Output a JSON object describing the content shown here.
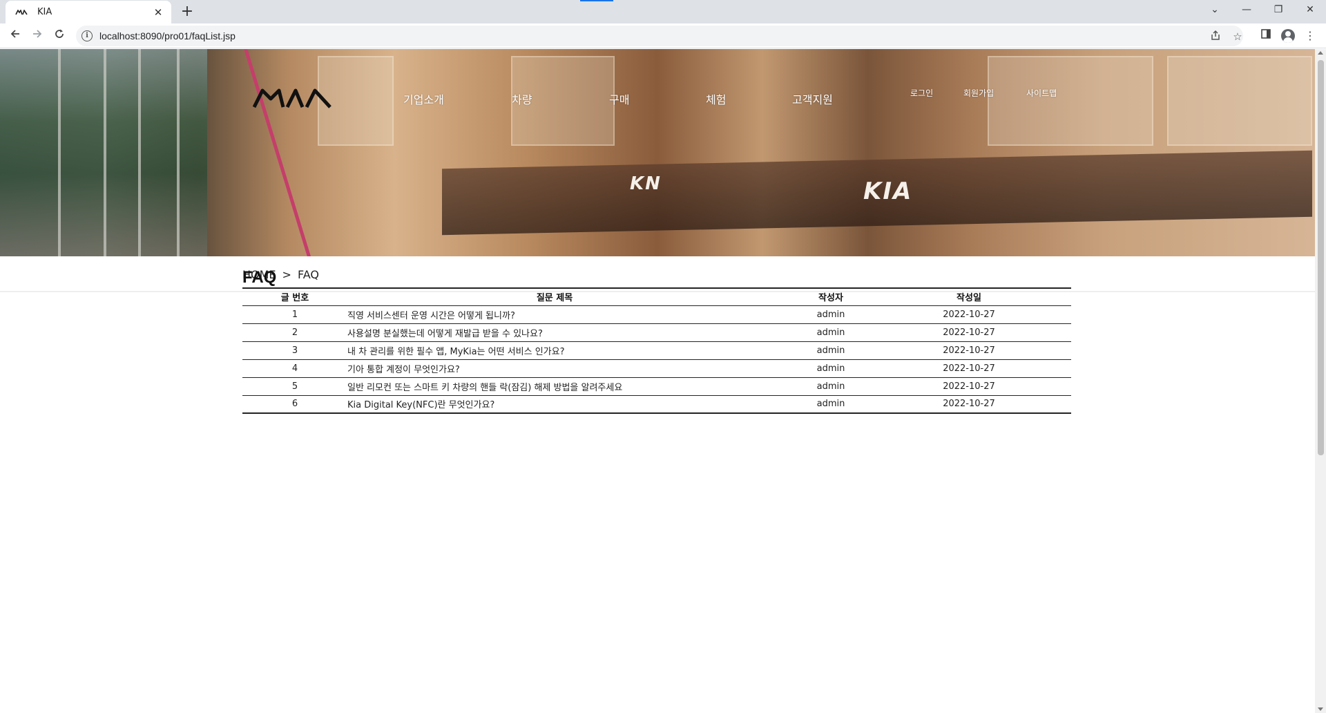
{
  "browser": {
    "tab_title": "KIA",
    "tab_close": "✕",
    "new_tab": "+",
    "url": "localhost:8090/pro01/faqList.jsp",
    "win_controls": {
      "dropdown": "⌄",
      "minimize": "—",
      "restore": "❐",
      "close": "✕"
    }
  },
  "header": {
    "logo": "KIA",
    "nav": [
      "기업소개",
      "차량",
      "구매",
      "체험",
      "고객지원"
    ],
    "util": [
      "로그인",
      "회원가입",
      "사이트맵"
    ],
    "hero_signs": [
      "KN",
      "KIA"
    ]
  },
  "breadcrumb": {
    "home": "HOME",
    "separator": ">",
    "current": "FAQ"
  },
  "page_title": "FAQ",
  "table": {
    "headers": {
      "num": "글 번호",
      "title": "질문 제목",
      "author": "작성자",
      "date": "작성일"
    },
    "rows": [
      {
        "num": "1",
        "title": "직영 서비스센터 운영 시간은 어떻게 됩니까?",
        "author": "admin",
        "date": "2022-10-27"
      },
      {
        "num": "2",
        "title": "사용설명 분실했는데 어떻게 재발급 받을 수 있나요?",
        "author": "admin",
        "date": "2022-10-27"
      },
      {
        "num": "3",
        "title": "내 차 관리를 위한 필수 앱, MyKia는 어떤 서비스 인가요?",
        "author": "admin",
        "date": "2022-10-27"
      },
      {
        "num": "4",
        "title": "기아 통합 계정이 무엇인가요?",
        "author": "admin",
        "date": "2022-10-27"
      },
      {
        "num": "5",
        "title": "일반 리모컨 또는 스마트 키 차량의 핸들 락(잠김) 해제 방법을 알려주세요",
        "author": "admin",
        "date": "2022-10-27"
      },
      {
        "num": "6",
        "title": "Kia Digital Key(NFC)란 무엇인가요?",
        "author": "admin",
        "date": "2022-10-27"
      }
    ]
  },
  "colors": {
    "accent_bar": "#1a73e8",
    "text": "#222222",
    "table_border": "#222222"
  }
}
